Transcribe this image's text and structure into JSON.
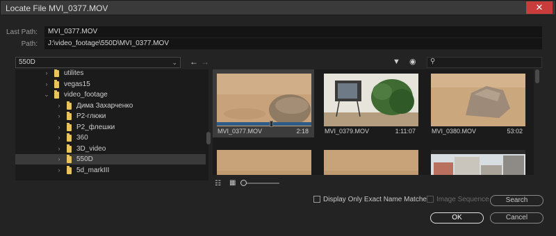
{
  "window": {
    "title": "Locate File MVI_0377.MOV",
    "close_glyph": "✕"
  },
  "paths": {
    "last_path_label": "Last Path:",
    "last_path_value": "MVI_0377.MOV",
    "path_label": "Path:",
    "path_value": "J:\\video_footage\\550D\\MVI_0377.MOV"
  },
  "folder_select": {
    "value": "550D"
  },
  "tree": {
    "items": [
      {
        "label": "utilites",
        "level": 0,
        "twisty": "›",
        "selected": false
      },
      {
        "label": "vegas15",
        "level": 0,
        "twisty": "›",
        "selected": false
      },
      {
        "label": "video_footage",
        "level": 0,
        "twisty": "⌄",
        "selected": false
      },
      {
        "label": "Дима Захарченко",
        "level": 1,
        "twisty": "›",
        "selected": false
      },
      {
        "label": "P2-глюки",
        "level": 1,
        "twisty": "›",
        "selected": false
      },
      {
        "label": "P2_флешки",
        "level": 1,
        "twisty": "›",
        "selected": false
      },
      {
        "label": "360",
        "level": 1,
        "twisty": "›",
        "selected": false
      },
      {
        "label": "3D_video",
        "level": 1,
        "twisty": "›",
        "selected": false
      },
      {
        "label": "550D",
        "level": 1,
        "twisty": "›",
        "selected": true
      },
      {
        "label": "5d_markIII",
        "level": 1,
        "twisty": "›",
        "selected": false
      }
    ]
  },
  "thumbnails": [
    {
      "name": "MVI_0377.MOV",
      "duration": "2:18",
      "selected": true,
      "scene": "sand-rock",
      "progress": 0.57
    },
    {
      "name": "MVI_0379.MOV",
      "duration": "1:11:07",
      "selected": false,
      "scene": "tv-plant"
    },
    {
      "name": "MVI_0380.MOV",
      "duration": "53:02",
      "selected": false,
      "scene": "boulder"
    },
    {
      "name": "",
      "duration": "",
      "selected": false,
      "scene": "sand"
    },
    {
      "name": "",
      "duration": "",
      "selected": false,
      "scene": "sand"
    },
    {
      "name": "",
      "duration": "",
      "selected": false,
      "scene": "buildings"
    }
  ],
  "options": {
    "exact_match_label": "Display Only Exact Name Matches",
    "image_sequence_label": "Image Sequence"
  },
  "buttons": {
    "search": "Search",
    "ok": "OK",
    "cancel": "Cancel"
  },
  "icons": {
    "back": "←",
    "forward": "→",
    "filter": "▼",
    "eye": "◉",
    "search": "⚲",
    "list_view": "☷",
    "icon_view": "▦",
    "folder": "folder-icon"
  },
  "colors": {
    "folder": "#e8c45a",
    "scrub_bar": "#2d5b86",
    "close_button": "#c83c3c"
  }
}
